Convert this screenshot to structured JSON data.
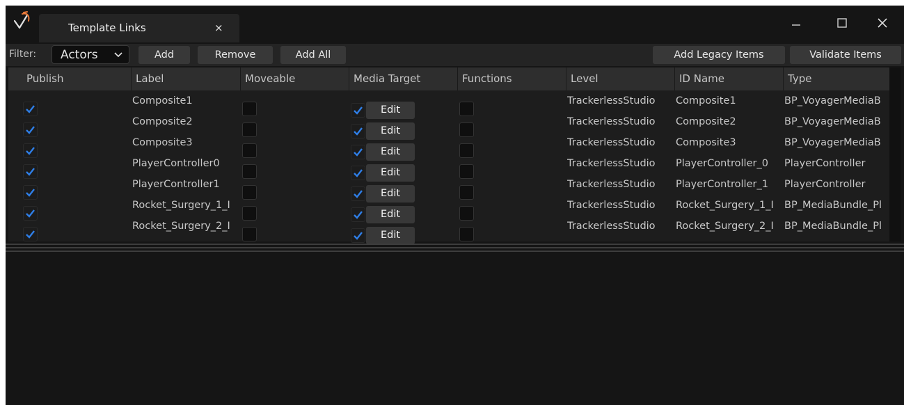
{
  "window": {
    "tab_title": "Template Links",
    "tab_close": "×"
  },
  "toolbar": {
    "filter_label": "Filter:",
    "filter_value": "Actors",
    "add": "Add",
    "remove": "Remove",
    "add_all": "Add All",
    "add_legacy": "Add Legacy Items",
    "validate": "Validate Items"
  },
  "table": {
    "columns": [
      "Publish",
      "Label",
      "Moveable",
      "Media Target",
      "Functions",
      "Level",
      "ID Name",
      "Type"
    ],
    "edit_label": "Edit",
    "rows": [
      {
        "publish": true,
        "label": "Composite1",
        "moveable": false,
        "media_target": true,
        "functions": false,
        "level": "TrackerlessStudio",
        "id_name": "Composite1",
        "type": "BP_VoyagerMediaB"
      },
      {
        "publish": true,
        "label": "Composite2",
        "moveable": false,
        "media_target": true,
        "functions": false,
        "level": "TrackerlessStudio",
        "id_name": "Composite2",
        "type": "BP_VoyagerMediaB"
      },
      {
        "publish": true,
        "label": "Composite3",
        "moveable": false,
        "media_target": true,
        "functions": false,
        "level": "TrackerlessStudio",
        "id_name": "Composite3",
        "type": "BP_VoyagerMediaB"
      },
      {
        "publish": true,
        "label": "PlayerController0",
        "moveable": false,
        "media_target": true,
        "functions": false,
        "level": "TrackerlessStudio",
        "id_name": "PlayerController_0",
        "type": "PlayerController"
      },
      {
        "publish": true,
        "label": "PlayerController1",
        "moveable": false,
        "media_target": true,
        "functions": false,
        "level": "TrackerlessStudio",
        "id_name": "PlayerController_1",
        "type": "PlayerController"
      },
      {
        "publish": true,
        "label": "Rocket_Surgery_1_I",
        "moveable": false,
        "media_target": true,
        "functions": false,
        "level": "TrackerlessStudio",
        "id_name": "Rocket_Surgery_1_I",
        "type": "BP_MediaBundle_Pl"
      },
      {
        "publish": true,
        "label": "Rocket_Surgery_2_I",
        "moveable": false,
        "media_target": true,
        "functions": false,
        "level": "TrackerlessStudio",
        "id_name": "Rocket_Surgery_2_I",
        "type": "BP_MediaBundle_Pl"
      }
    ]
  },
  "colors": {
    "check": "#2f7fe8",
    "logo": "#e8793a",
    "background": "#151515"
  },
  "icons": [
    "app-logo-icon",
    "close-icon",
    "minimize-icon",
    "maximize-icon",
    "chevron-down-icon",
    "checkmark-icon"
  ]
}
